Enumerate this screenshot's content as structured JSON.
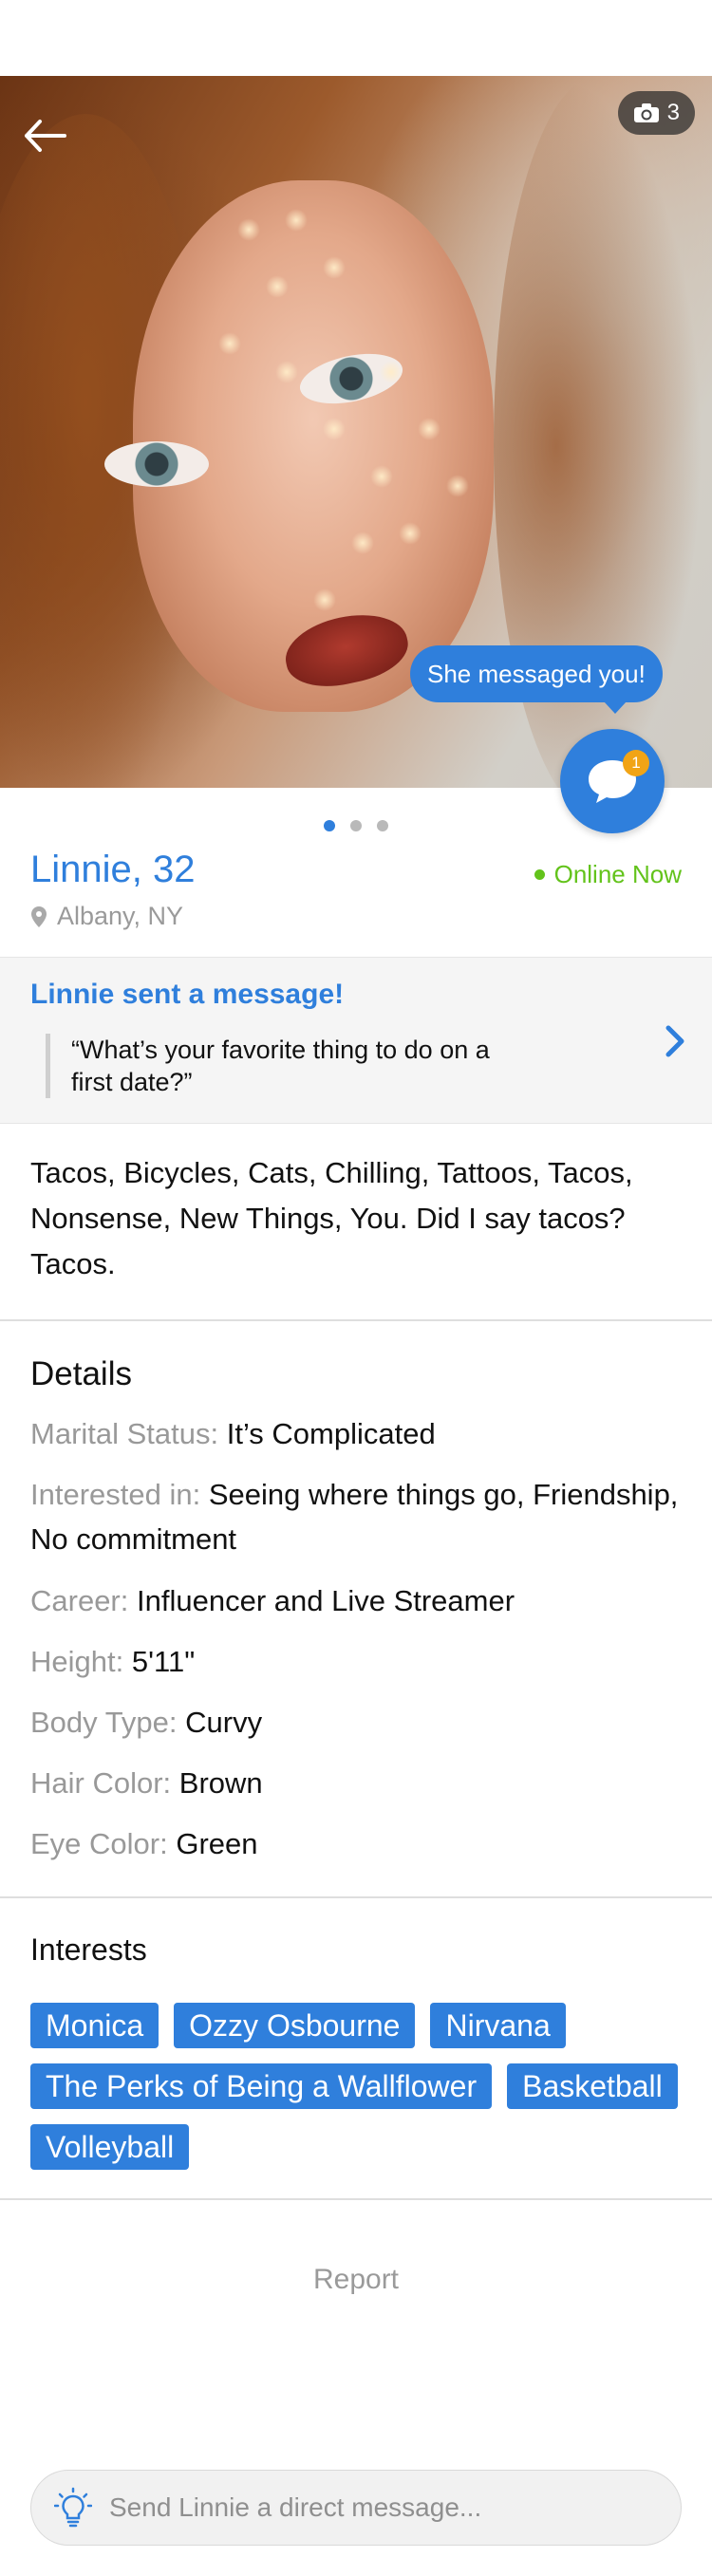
{
  "photo": {
    "photo_count": "3",
    "message_bubble": "She messaged you!",
    "chat_badge_count": "1",
    "page_dots": 3,
    "active_dot": 0
  },
  "profile": {
    "name_age": "Linnie, 32",
    "online_status": "Online Now",
    "location": "Albany, NY"
  },
  "sent_message": {
    "title": "Linnie sent a message!",
    "quote": "“What’s your favorite thing to do on a first date?”"
  },
  "bio": "Tacos, Bicycles, Cats, Chilling, Tattoos, Tacos, Nonsense, New Things, You. Did I say tacos? Tacos.",
  "details": {
    "title": "Details",
    "items": [
      {
        "key": "Marital Status:",
        "value": "It’s Complicated"
      },
      {
        "key": "Interested in:",
        "value": "Seeing where things go, Friendship, No commitment"
      },
      {
        "key": "Career:",
        "value": "Influencer and Live Streamer"
      },
      {
        "key": "Height:",
        "value": "5'11\""
      },
      {
        "key": "Body Type:",
        "value": "Curvy"
      },
      {
        "key": "Hair Color:",
        "value": "Brown"
      },
      {
        "key": "Eye Color:",
        "value": "Green"
      }
    ]
  },
  "interests": {
    "title": "Interests",
    "chips": [
      "Monica",
      "Ozzy Osbourne",
      "Nirvana",
      "The Perks of Being a Wallflower",
      "Basketball",
      "Volleyball"
    ]
  },
  "report_label": "Report",
  "dm": {
    "placeholder": "Send Linnie a direct message..."
  },
  "colors": {
    "accent": "#2f7fdc",
    "online": "#63c31b",
    "badge": "#f1a416"
  }
}
